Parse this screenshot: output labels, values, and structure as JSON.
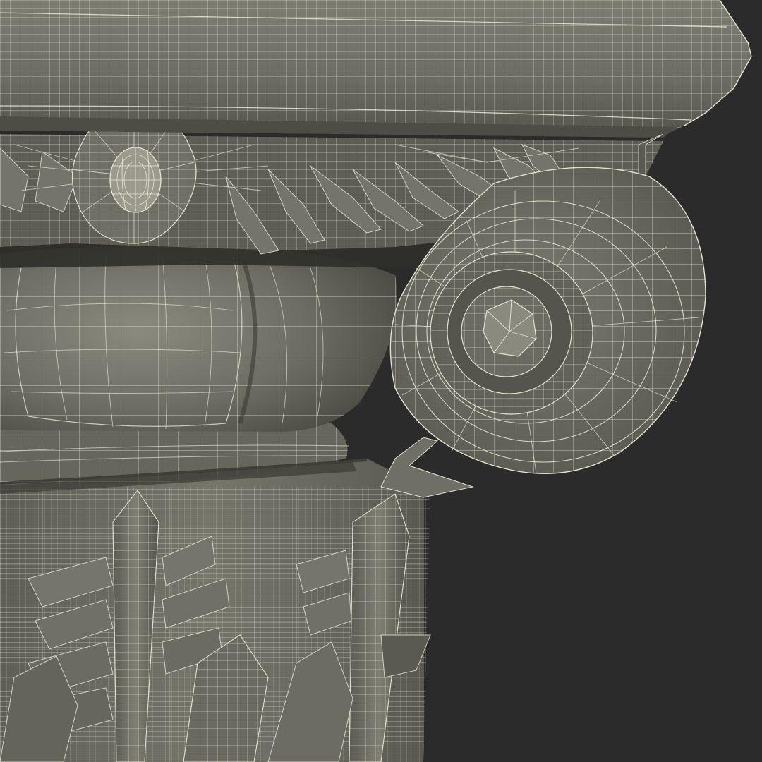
{
  "scene": {
    "subject": "composite-capital-wireframe-render",
    "colors": {
      "background": "#2b2b2b",
      "surface": "#6a6a62",
      "surface_light": "#858579",
      "surface_dark": "#4f4f48",
      "shadow": "#36362f",
      "wire": "#e4e2cf"
    }
  }
}
